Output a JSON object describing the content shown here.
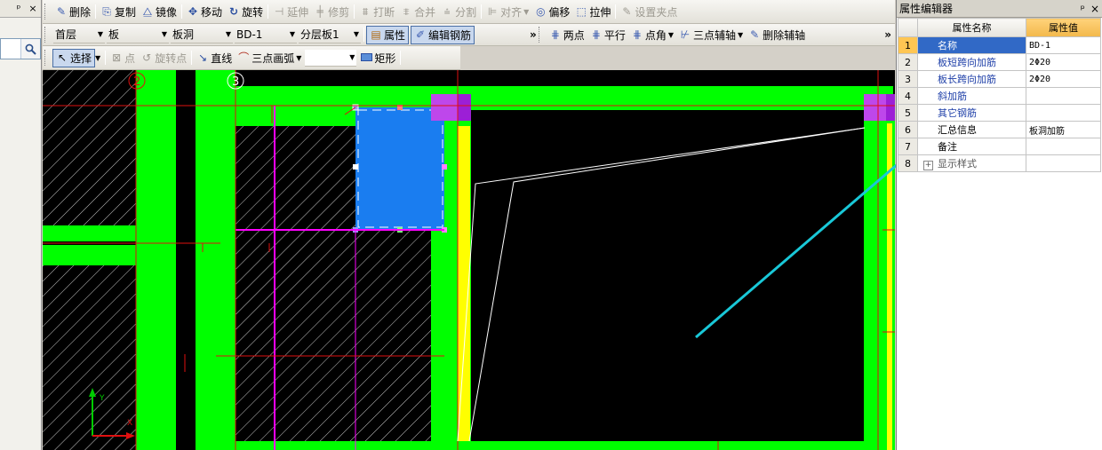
{
  "left_pane": {
    "pin": "ᵖ",
    "close": "×"
  },
  "toolbar1": {
    "items": [
      {
        "label": "删除",
        "icon": "eraser-icon",
        "enabled": true
      },
      {
        "label": "复制",
        "icon": "copy-icon",
        "enabled": true
      },
      {
        "label": "镜像",
        "icon": "mirror-icon",
        "enabled": true
      },
      {
        "label": "移动",
        "icon": "move-icon",
        "enabled": true
      },
      {
        "label": "旋转",
        "icon": "rotate-icon",
        "enabled": true
      },
      {
        "label": "延伸",
        "icon": "extend-icon",
        "enabled": false
      },
      {
        "label": "修剪",
        "icon": "trim-icon",
        "enabled": false
      },
      {
        "label": "打断",
        "icon": "break-icon",
        "enabled": false
      },
      {
        "label": "合并",
        "icon": "merge-icon",
        "enabled": false
      },
      {
        "label": "分割",
        "icon": "split-icon",
        "enabled": false
      },
      {
        "label": "对齐",
        "icon": "align-icon",
        "enabled": false
      },
      {
        "label": "偏移",
        "icon": "offset-icon",
        "enabled": true
      },
      {
        "label": "拉伸",
        "icon": "stretch-icon",
        "enabled": true
      },
      {
        "label": "设置夹点",
        "icon": "grip-point-icon",
        "enabled": false
      }
    ]
  },
  "toolbar2": {
    "floor_select": "首层",
    "category_select": "板",
    "type_select": "板洞",
    "element_select": "BD-1",
    "layer_select": "分层板1",
    "property_button": "属性",
    "edit_rebar_button": "编辑钢筋",
    "more": "»",
    "axis_items": [
      {
        "label": "两点",
        "icon": "two-point-axis-icon"
      },
      {
        "label": "平行",
        "icon": "parallel-axis-icon"
      },
      {
        "label": "点角",
        "icon": "point-angle-axis-icon"
      },
      {
        "label": "三点辅轴",
        "icon": "three-point-axis-icon"
      },
      {
        "label": "删除辅轴",
        "icon": "delete-axis-icon"
      }
    ],
    "more2": "»"
  },
  "toolbar3": {
    "select_button": "选择",
    "point_button": "点",
    "rotate_point_button": "旋转点",
    "line_button": "直线",
    "arc_button": "三点画弧",
    "arc_option_value": "",
    "rect_button": "矩形"
  },
  "canvas": {
    "grid_labels": [
      "2",
      "3"
    ],
    "axis_x_label": "X",
    "axis_y_label": "Y",
    "colors": {
      "background": "#000000",
      "beam_green": "#00ff00",
      "selected_blue": "#1a7df0",
      "column_purple": "#9c1fd6",
      "wall_yellow": "#ffff00",
      "axis_line_red": "#e01010",
      "rebar_magenta": "#ff00ff",
      "annotation_arrow": "#19c8d8"
    }
  },
  "property_panel": {
    "title": "属性编辑器",
    "pin": "ᵖ",
    "close": "×",
    "col_name": "属性名称",
    "col_value": "属性值",
    "rows": [
      {
        "num": "1",
        "name": "名称",
        "value": "BD-1",
        "selected": true
      },
      {
        "num": "2",
        "name": "板短跨向加筋",
        "value": "2Φ20"
      },
      {
        "num": "3",
        "name": "板长跨向加筋",
        "value": "2Φ20"
      },
      {
        "num": "4",
        "name": "斜加筋",
        "value": ""
      },
      {
        "num": "5",
        "name": "其它钢筋",
        "value": ""
      },
      {
        "num": "6",
        "name": "汇总信息",
        "value": "板洞加筋"
      },
      {
        "num": "7",
        "name": "备注",
        "value": ""
      },
      {
        "num": "8",
        "name": "显示样式",
        "value": "",
        "expander": "+"
      }
    ]
  }
}
